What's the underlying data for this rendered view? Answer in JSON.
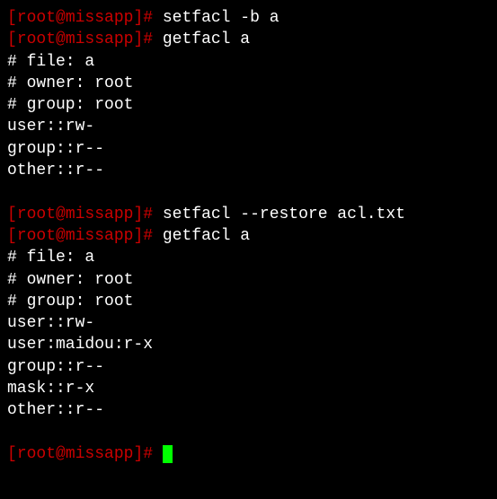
{
  "prompt": {
    "open_bracket": "[",
    "user_host": "root@missapp",
    "close_bracket": "]",
    "hash": "#"
  },
  "commands": {
    "setfacl_b": "setfacl -b a",
    "getfacl1": "getfacl a",
    "setfacl_restore": "setfacl --restore acl.txt",
    "getfacl2": "getfacl a"
  },
  "output1": {
    "file": "# file: a",
    "owner": "# owner: root",
    "group": "# group: root",
    "user_perm": "user::rw-",
    "group_perm": "group::r--",
    "other_perm": "other::r--"
  },
  "output2": {
    "file": "# file: a",
    "owner": "# owner: root",
    "group": "# group: root",
    "user_perm": "user::rw-",
    "user_maidou": "user:maidou:r-x",
    "group_perm": "group::r--",
    "mask_perm": "mask::r-x",
    "other_perm": "other::r--"
  }
}
